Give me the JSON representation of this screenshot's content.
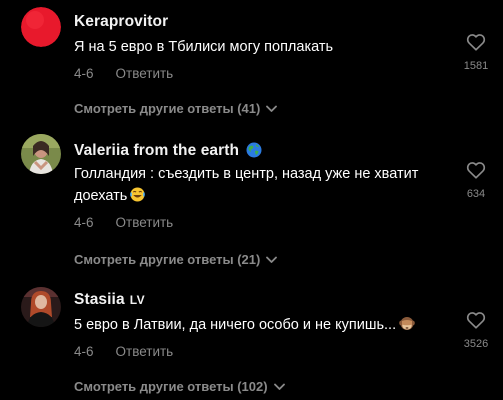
{
  "comments": [
    {
      "username": "Keraprovitor",
      "text": "Я на 5 евро в Тбилиси могу поплакать",
      "date": "4-6",
      "reply_label": "Ответить",
      "likes": "1581",
      "view_replies": "Смотреть другие ответы (41)",
      "avatar_icon": "red-circle-avatar"
    },
    {
      "username": "Valeriia from the earth",
      "username_badge_icon": "globe-emoji-icon",
      "text": "Голландия : съездить в центр, назад уже не хватит доехать",
      "text_emoji_icon": "laughing-emoji-icon",
      "date": "4-6",
      "reply_label": "Ответить",
      "likes": "634",
      "view_replies": "Смотреть другие ответы (21)",
      "avatar_icon": "user-photo-avatar"
    },
    {
      "username": "Stasiia",
      "username_suffix": "LV",
      "text": "5 евро в Латвии, да ничего особо и не купишь...",
      "text_emoji_icon": "see-no-evil-monkey-emoji-icon",
      "date": "4-6",
      "reply_label": "Ответить",
      "likes": "3526",
      "view_replies": "Смотреть другие ответы (102)",
      "avatar_icon": "user-photo-avatar"
    }
  ],
  "colors": {
    "background": "#000000",
    "primary_text": "#ffffff",
    "secondary_text": "#8a8a8a",
    "avatar_red": "#e8192c"
  }
}
